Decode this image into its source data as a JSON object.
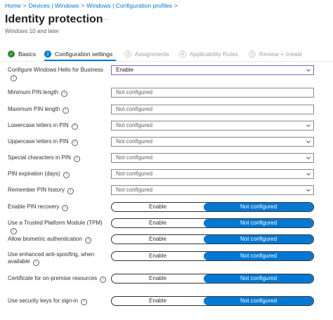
{
  "breadcrumb": {
    "items": [
      "Home",
      "Devices | Windows",
      "Windows | Configuration profiles"
    ]
  },
  "header": {
    "title": "Identity protection",
    "more": "···",
    "subtitle": "Windows 10 and later"
  },
  "steps": [
    {
      "number": "✓",
      "label": "Basics",
      "state": "done"
    },
    {
      "number": "2",
      "label": "Configuration settings",
      "state": "active"
    },
    {
      "number": "3",
      "label": "Assignments",
      "state": "inactive"
    },
    {
      "number": "4",
      "label": "Applicability Rules",
      "state": "inactive"
    },
    {
      "number": "5",
      "label": "Review + create",
      "state": "inactive"
    }
  ],
  "settings": {
    "hello": {
      "label": "Configure Windows Hello for Business",
      "value": "Enable"
    },
    "min_pin": {
      "label": "Minimum PIN length",
      "value": "Not configured"
    },
    "max_pin": {
      "label": "Maximum PIN length",
      "value": "Not configured"
    },
    "lowercase": {
      "label": "Lowercase letters in PIN",
      "value": "Not configured"
    },
    "uppercase": {
      "label": "Uppercase letters in PIN",
      "value": "Not configured"
    },
    "special": {
      "label": "Special characters in PIN",
      "value": "Not configured"
    },
    "expiration": {
      "label": "PIN expiration (days)",
      "value": "Not configured"
    },
    "history": {
      "label": "Remember PIN history",
      "value": "Not configured"
    },
    "recovery": {
      "label": "Enable PIN recovery",
      "option_a": "Enable",
      "option_b": "Not configured"
    },
    "tpm": {
      "label": "Use a Trusted Platform Module (TPM)",
      "option_a": "Enable",
      "option_b": "Not configured"
    },
    "biometric": {
      "label": "Allow biometric authentication",
      "option_a": "Enable",
      "option_b": "Not configured"
    },
    "antispoof": {
      "label_line1": "Use enhanced anti-spoofing, when",
      "label_line2": "available",
      "option_a": "Enable",
      "option_b": "Not configured"
    },
    "onprem": {
      "label": "Certificate for on-premise resources",
      "option_a": "Enable",
      "option_b": "Not configured"
    },
    "seckeys": {
      "label": "Use security keys for sign-in",
      "option_a": "Enable",
      "option_b": "Not configured"
    }
  },
  "icons": {
    "info": "info-icon",
    "chevron": "chevron-down-icon",
    "check": "checkmark-icon"
  },
  "colors": {
    "accent": "#0078d4",
    "done": "#2f8a2f",
    "focus_border": "#8764b8"
  }
}
